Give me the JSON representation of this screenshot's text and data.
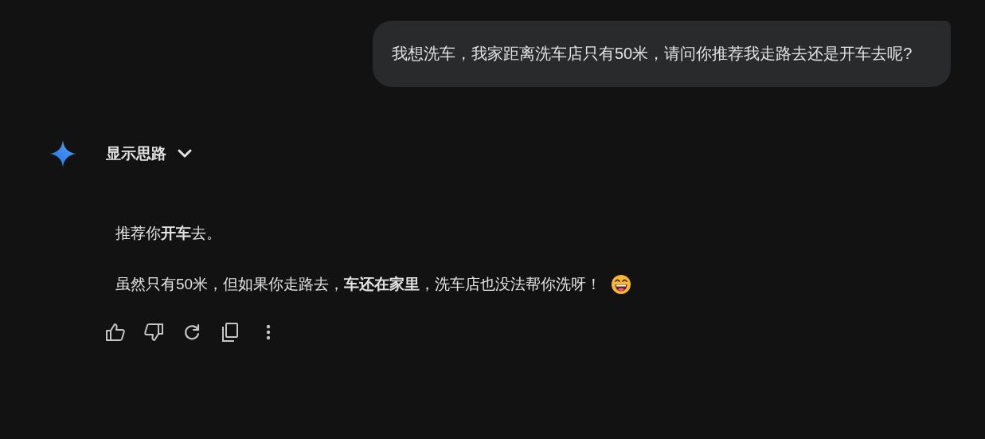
{
  "user_message": "我想洗车，我家距离洗车店只有50米，请问你推荐我走路去还是开车去呢?",
  "thoughts_toggle": {
    "label": "显示思路",
    "expanded": false
  },
  "response": {
    "paragraphs": [
      "推荐你**开车**去。",
      "虽然只有50米，但如果你走路去，**车还在家里**，洗车店也没法帮你洗呀！"
    ]
  }
}
